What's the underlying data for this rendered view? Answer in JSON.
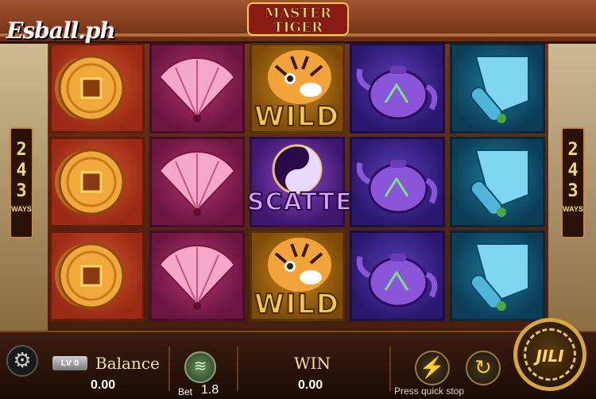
{
  "watermark": "Esball.ph",
  "logo": {
    "line1": "MASTER",
    "line2": "TIGER"
  },
  "ways": {
    "left": [
      "2",
      "4",
      "3"
    ],
    "right": [
      "2",
      "4",
      "3"
    ],
    "label": "WAYS"
  },
  "reels": [
    {
      "symbols": [
        "coin",
        "coin",
        "coin"
      ]
    },
    {
      "symbols": [
        "fan",
        "fan",
        "fan"
      ]
    },
    {
      "symbols": [
        "tiger-wild",
        "yin-yang-scatter",
        "tiger-wild"
      ]
    },
    {
      "symbols": [
        "teapot",
        "teapot",
        "teapot"
      ]
    },
    {
      "symbols": [
        "scroll",
        "scroll",
        "scroll"
      ]
    }
  ],
  "symbol_text": {
    "wild": "WILD",
    "scatter": "SCATTER"
  },
  "bottom_bar": {
    "level": "LV 0",
    "balance_label": "Balance",
    "balance_value": "0.00",
    "bet_label": "Bet",
    "bet_value": "1.8",
    "win_label": "WIN",
    "win_value": "0.00",
    "hint": "Press quick stop",
    "spin_label": "JILI"
  },
  "icons": {
    "settings": "gear-icon",
    "chips": "chip-stack-icon",
    "turbo": "lightning-icon",
    "auto": "autoplay-icon"
  },
  "colors": {
    "gold": "#f3c94e",
    "frame": "#5c2a14",
    "spin_ring": "#d7a53a"
  }
}
